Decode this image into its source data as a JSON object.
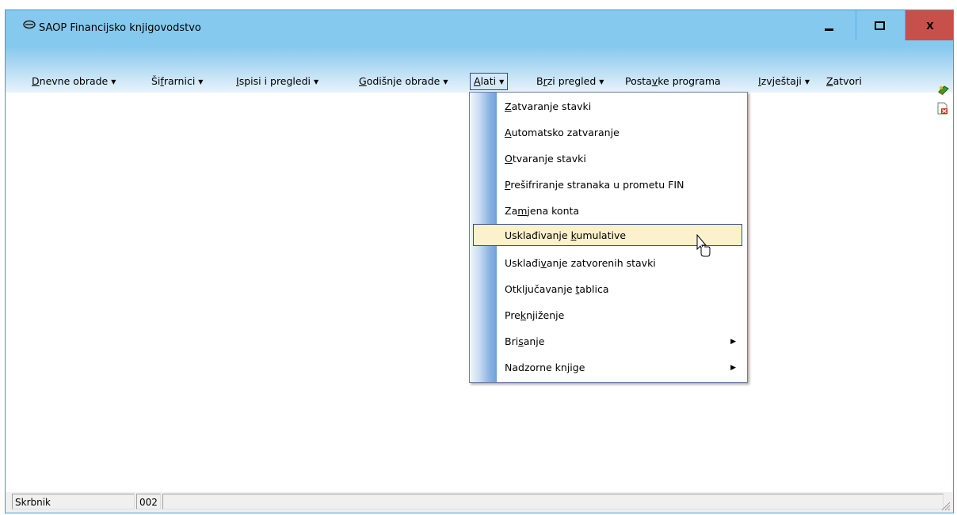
{
  "window": {
    "title": "SAOP Financijsko knjigovodstvo",
    "app_icon": "saop-logo-icon",
    "controls": {
      "minimize": "minimize-icon",
      "maximize": "maximize-icon",
      "close_label": "X"
    }
  },
  "menubar": {
    "items": [
      {
        "pre": "",
        "u": "D",
        "post": "nevne obrade",
        "has_arrow": true
      },
      {
        "pre": "Ši",
        "u": "f",
        "post": "rarnici",
        "has_arrow": true
      },
      {
        "pre": "",
        "u": "I",
        "post": "spisi i pregledi",
        "has_arrow": true
      },
      {
        "pre": "",
        "u": "G",
        "post": "odišnje obrade",
        "has_arrow": true
      },
      {
        "pre": "",
        "u": "A",
        "post": "lati",
        "has_arrow": true
      },
      {
        "pre": "B",
        "u": "r",
        "post": "zi pregled",
        "has_arrow": true
      },
      {
        "pre": "Posta",
        "u": "v",
        "post": "ke programa",
        "has_arrow": false
      },
      {
        "pre": "",
        "u": "I",
        "post": "zvještaji",
        "has_arrow": true
      },
      {
        "pre": "",
        "u": "Z",
        "post": "atvori",
        "has_arrow": false
      }
    ],
    "arrow_glyph": "▼",
    "tool_icons": [
      "books-icon",
      "close-document-icon"
    ]
  },
  "dropdown": {
    "items": [
      {
        "pre": "",
        "u": "Z",
        "post": "atvaranje stavki",
        "submenu": false
      },
      {
        "pre": "",
        "u": "A",
        "post": "utomatsko zatvaranje",
        "submenu": false
      },
      {
        "pre": "",
        "u": "O",
        "post": "tvaranje stavki",
        "submenu": false
      },
      {
        "pre": "",
        "u": "P",
        "post": "rešifriranje stranaka u prometu FIN",
        "submenu": false
      },
      {
        "pre": "Za",
        "u": "m",
        "post": "jena konta",
        "submenu": false
      },
      {
        "pre": "Usklađivanje ",
        "u": "k",
        "post": "umulative",
        "submenu": false,
        "highlighted": true
      },
      {
        "pre": "Usklađi",
        "u": "v",
        "post": "anje zatvorenih stavki",
        "submenu": false
      },
      {
        "pre": "Otključavanje ",
        "u": "t",
        "post": "ablica",
        "submenu": false
      },
      {
        "pre": "Pre",
        "u": "k",
        "post": "njiženje",
        "submenu": false
      },
      {
        "pre": "Bri",
        "u": "s",
        "post": "anje",
        "submenu": true
      },
      {
        "pre": "Nadzorne knjige",
        "u": "",
        "post": "",
        "submenu": true
      }
    ],
    "submenu_glyph": "▶"
  },
  "statusbar": {
    "user": "Skrbnik",
    "code": "002",
    "message": ""
  },
  "colors": {
    "titlebar": "#85c9ee",
    "close_button": "#c7504a",
    "highlight": "#fbf1cc",
    "gutter": "#6f9fd8"
  }
}
